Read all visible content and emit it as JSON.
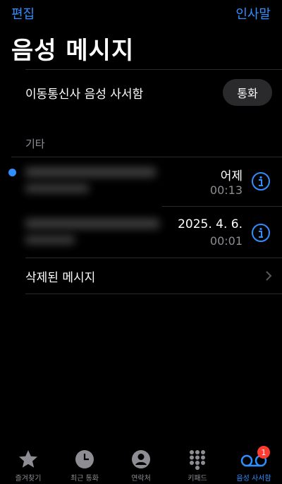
{
  "topbar": {
    "edit_label": "편집",
    "greeting_label": "인사말"
  },
  "page": {
    "title": "음성 메시지"
  },
  "carrier": {
    "label": "이동통신사 음성 사서함",
    "call_label": "통화"
  },
  "section": {
    "header": "기타"
  },
  "voicemails": [
    {
      "date": "어제",
      "duration": "00:13",
      "unread": true
    },
    {
      "date": "2025. 4. 6.",
      "duration": "00:01",
      "unread": false
    }
  ],
  "deleted": {
    "label": "삭제된 메시지"
  },
  "tabbar": {
    "items": [
      {
        "label": "즐겨찾기",
        "icon": "star-icon"
      },
      {
        "label": "최근 통화",
        "icon": "clock-icon"
      },
      {
        "label": "연락처",
        "icon": "contact-icon"
      },
      {
        "label": "키패드",
        "icon": "keypad-icon"
      },
      {
        "label": "음성 사서함",
        "icon": "voicemail-icon",
        "badge": "1",
        "active": true
      }
    ]
  },
  "colors": {
    "accent": "#2f8fff",
    "badge": "#ff3b30",
    "secondary_text": "#8d8d93"
  }
}
